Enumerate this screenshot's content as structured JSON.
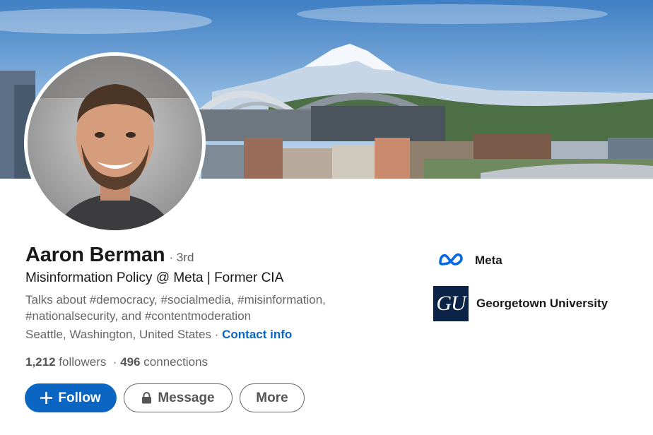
{
  "profile": {
    "name": "Aaron Berman",
    "degree": "· 3rd",
    "headline": "Misinformation Policy @ Meta | Former CIA",
    "talks_about": "Talks about #democracy, #socialmedia, #misinformation, #nationalsecurity, and #contentmoderation",
    "location": "Seattle, Washington, United States",
    "location_separator": " · ",
    "contact_info_label": "Contact info",
    "followers_count": "1,212",
    "followers_label": " followers",
    "connections_separator": "  · ",
    "connections_count": "496",
    "connections_label": " connections"
  },
  "actions": {
    "follow_label": "Follow",
    "message_label": "Message",
    "more_label": "More"
  },
  "companies": [
    {
      "name": "Meta",
      "icon": "meta-logo"
    },
    {
      "name": "Georgetown University",
      "icon": "georgetown-logo",
      "logo_text": "GU"
    }
  ],
  "colors": {
    "brand_blue": "#0a66c2",
    "meta_blue": "#0668e1",
    "georgetown_navy": "#0b2347"
  }
}
